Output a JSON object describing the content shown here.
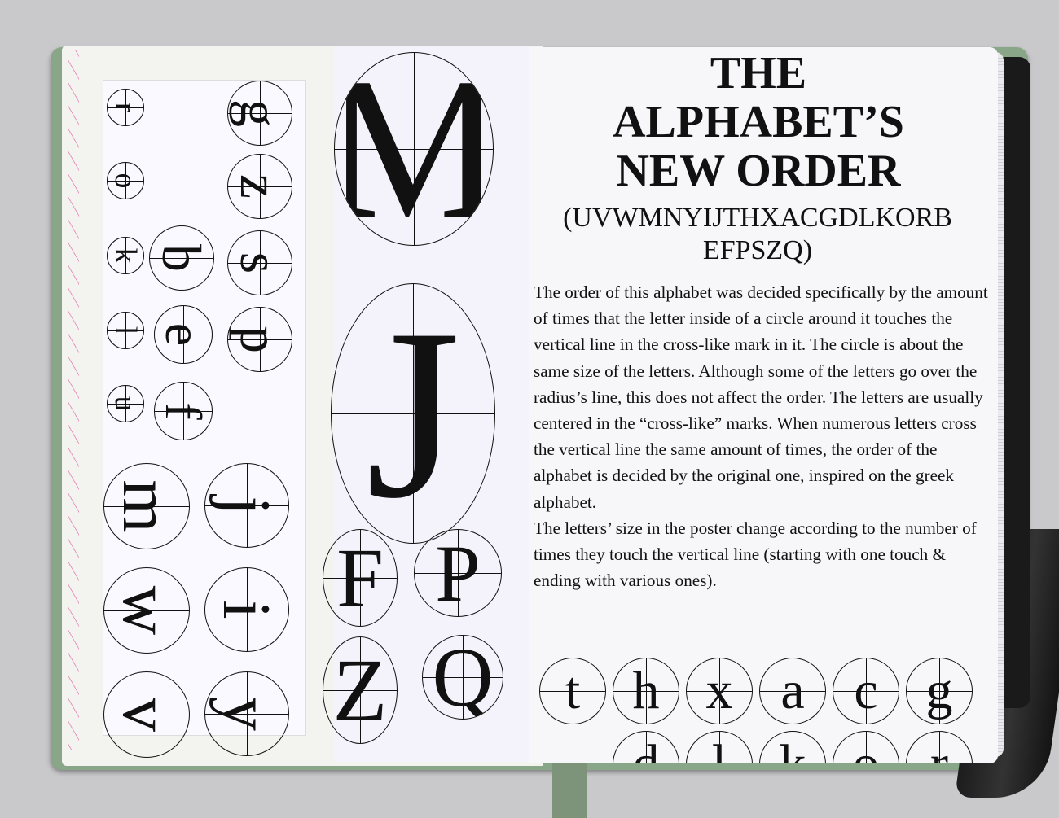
{
  "poster": {
    "title_lines": [
      "THE",
      "ALPHABET’S",
      "NEW ORDER"
    ],
    "order_lines": [
      "(UVWMNYIJTHXACGDLKORB",
      "EFPSZQ)"
    ],
    "paragraph_1": "The order of this alphabet was decided specifically by the amount of times that the letter inside of a circle around it touches the vertical line in the cross-like mark in it. The circle is about the same size of the letters. Although some of the letters go over the radius’s line, this does not affect the order. The letters are usually centered in the “cross-like” marks. When numerous letters cross the vertical line the same amount of times, the order of the alphabet is decided by the original one, inspired on the greek alphabet.",
    "paragraph_2": "The letters’ size in the poster change according to the number of times they touch the vertical line (starting with one touch & ending with various ones)."
  },
  "bottom_row_letters": [
    "t",
    "h",
    "x",
    "a",
    "c",
    "g"
  ],
  "bottom_row2_letters": [
    "d",
    "l",
    "k",
    "o",
    "r"
  ],
  "middle_sheet_letters": {
    "large": [
      "M",
      "J"
    ],
    "small": [
      "F",
      "P",
      "Z",
      "Q"
    ]
  },
  "strip_letters": {
    "column_1": [
      "r",
      "o",
      "k",
      "l",
      "u",
      "m",
      "w",
      "v"
    ],
    "column_2": [
      "b",
      "e",
      "f",
      "j",
      "i",
      "y"
    ],
    "column_3": [
      "g",
      "z",
      "s",
      "p"
    ]
  },
  "colors": {
    "cover": "#8aa688",
    "page": "#f7f7fa",
    "ink": "#111111",
    "margin_stripe": "#e05aa5"
  }
}
